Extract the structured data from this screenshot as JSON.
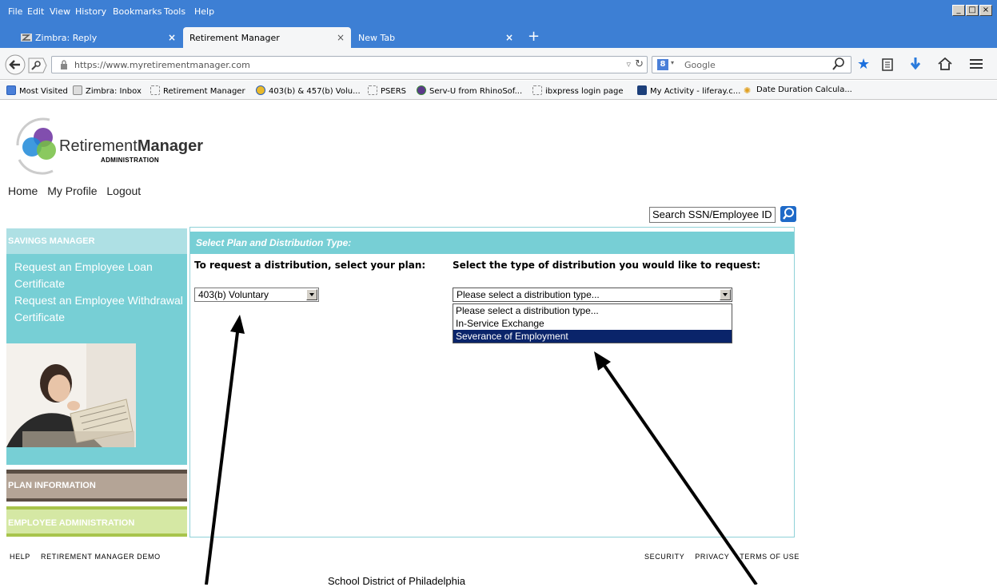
{
  "browser": {
    "menu": [
      "File",
      "Edit",
      "View",
      "History",
      "Bookmarks",
      "Tools",
      "Help"
    ],
    "tabs": [
      {
        "label": "Zimbra: Reply",
        "active": false
      },
      {
        "label": "Retirement Manager",
        "active": true
      },
      {
        "label": "New Tab",
        "active": false
      }
    ],
    "url": "https://www.myretirementmanager.com",
    "search_placeholder": "Google",
    "bookmarks": [
      "Most Visited",
      "Zimbra: Inbox",
      "Retirement Manager",
      "403(b) & 457(b) Volu...",
      "PSERS",
      "Serv-U from RhinoSof...",
      "ibxpress login page",
      "My Activity - liferay.c...",
      "Date Duration Calcula..."
    ]
  },
  "site": {
    "logo_text": "Retirement",
    "logo_text_bold": "Manager",
    "logo_sub": "ADMINISTRATION",
    "nav": [
      "Home",
      "My Profile",
      "Logout"
    ],
    "search_label": "Search SSN/Employee ID"
  },
  "sidebar": {
    "header": "SAVINGS MANAGER",
    "links": [
      "Request an Employee Loan Certificate",
      "Request an Employee Withdrawal Certificate"
    ],
    "sections": [
      "PLAN INFORMATION",
      "EMPLOYEE ADMINISTRATION"
    ]
  },
  "main": {
    "title": "Select Plan and Distribution Type:",
    "plan_label": "To request a distribution, select your plan:",
    "plan_value": "403(b) Voluntary",
    "dist_label": "Select the type of distribution you would like to request:",
    "dist_value": "Please select a distribution type...",
    "dist_options": [
      "Please select a distribution type...",
      "In-Service Exchange",
      "Severance of Employment"
    ],
    "dist_highlighted": "Severance of Employment"
  },
  "footer": {
    "left": [
      "HELP",
      "RETIREMENT MANAGER DEMO"
    ],
    "right": [
      "SECURITY",
      "PRIVACY",
      "TERMS OF USE"
    ],
    "district": "School District of Philadelphia"
  },
  "colors": {
    "chrome_blue": "#3d7fd4",
    "teal": "#77cfd5",
    "teal_light": "#aee0e4",
    "plan_brown": "#b4a496",
    "admin_green": "#d5e8a4",
    "select_highlight": "#0a246a"
  }
}
